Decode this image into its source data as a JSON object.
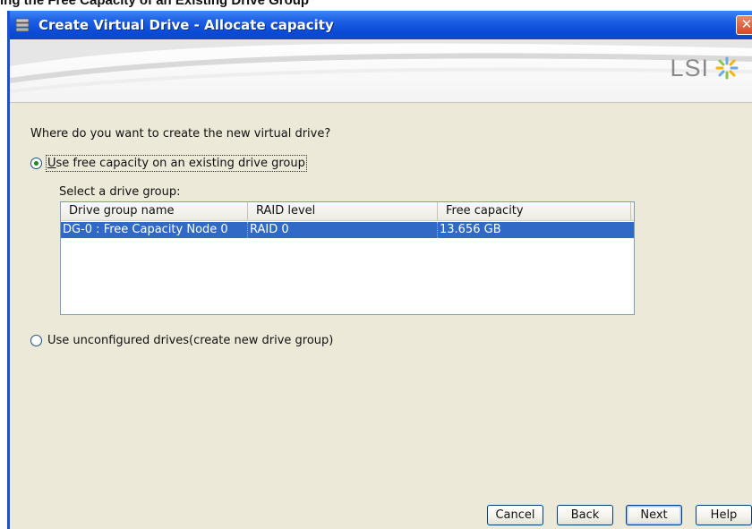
{
  "doc_caption": "ing the Free Capacity of an Existing Drive Group",
  "window": {
    "title": "Create Virtual Drive - Allocate capacity",
    "close_glyph": "✕",
    "logo_text": "LSI"
  },
  "content": {
    "question": "Where do you want to create the new virtual drive?",
    "option_existing": {
      "mnemonic": "U",
      "rest": "se free capacity on an existing drive group",
      "checked": true
    },
    "select_label": "Select a drive group:",
    "table": {
      "columns": [
        "Drive group name",
        "RAID level",
        "Free capacity"
      ],
      "rows": [
        {
          "name": "DG-0 : Free Capacity Node 0",
          "raid": "RAID 0",
          "free": "13.656 GB",
          "selected": true
        }
      ]
    },
    "option_unconfigured": {
      "label": "Use unconfigured drives(create new drive group)",
      "checked": false
    }
  },
  "buttons": {
    "cancel": "Cancel",
    "back": "Back",
    "next": "Next",
    "help": "Help"
  },
  "colors": {
    "titlebar": "#0a4ad8",
    "selection": "#3169c6",
    "dialog_bg": "#ece9d8"
  },
  "icons": {
    "title": "drive-stack-icon",
    "close": "close-icon",
    "logo": "lsi-starburst-icon"
  }
}
